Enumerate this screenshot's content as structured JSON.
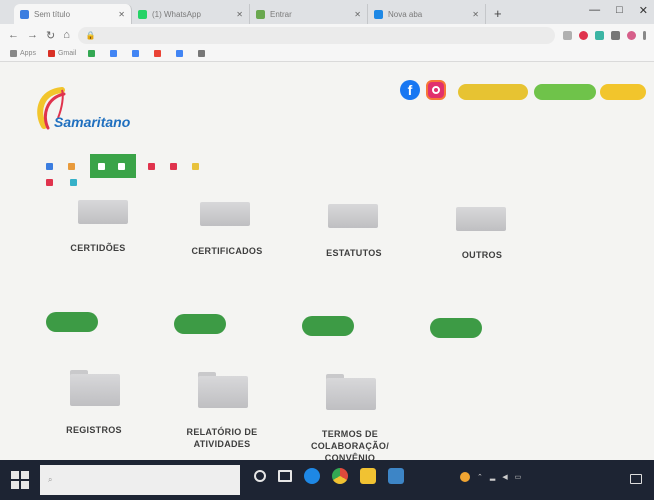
{
  "browser": {
    "tabs": [
      {
        "title": "Sem título",
        "color": "#3b7de0",
        "active": true
      },
      {
        "title": "(1) WhatsApp",
        "color": "#25d366",
        "active": false
      },
      {
        "title": "Entrar",
        "color": "#6aa84f",
        "active": false
      },
      {
        "title": "Nova aba",
        "color": "#1e88e5",
        "active": false
      }
    ],
    "new_tab_label": "+",
    "window_controls": [
      "—",
      "□",
      "✕"
    ],
    "nav_buttons": [
      "←",
      "→",
      "↻",
      "⌂"
    ],
    "lock_icon": "lock-icon",
    "url": "",
    "bookmarks": [
      {
        "label": "Apps",
        "color": "#888888"
      },
      {
        "label": "Gmail",
        "color": "#d93025"
      },
      {
        "label": "",
        "color": "#34a853"
      },
      {
        "label": "",
        "color": "#4285f4"
      },
      {
        "label": "",
        "color": "#4285f4"
      },
      {
        "label": "",
        "color": "#ea4335"
      },
      {
        "label": "",
        "color": "#4285f4"
      },
      {
        "label": "",
        "color": "#777777"
      }
    ]
  },
  "site": {
    "logo_text": "Samaritano",
    "logo_sub": "",
    "social": {
      "facebook": "f",
      "instagram": "instagram-icon"
    },
    "pills": [
      "",
      "",
      ""
    ],
    "nav_row1": [
      {
        "label": "",
        "color": "#3b7de0",
        "highlight": false
      },
      {
        "label": "",
        "color": "#e89a3c",
        "highlight": false
      }
    ],
    "nav_highlight": [
      "",
      ""
    ],
    "nav_row1_after": [
      {
        "label": "",
        "color": "#e0334d"
      },
      {
        "label": "",
        "color": "#e0334d"
      },
      {
        "label": "",
        "color": "#e8c23c"
      }
    ],
    "nav_row2": [
      {
        "label": "",
        "color": "#e0334d"
      },
      {
        "label": "",
        "color": "#35b0c8"
      }
    ]
  },
  "folders_row1": [
    {
      "label": "CERTIDÕES"
    },
    {
      "label": "CERTIFICADOS"
    },
    {
      "label": "ESTATUTOS"
    },
    {
      "label": "OUTROS"
    }
  ],
  "view_buttons": [
    "",
    "",
    "",
    ""
  ],
  "folders_row2": [
    {
      "label": "REGISTROS"
    },
    {
      "label": "RELATÓRIO DE ATIVIDADES"
    },
    {
      "label": "TERMOS DE COLABORAÇÃO/ CONVÊNIO"
    }
  ],
  "taskbar": {
    "search_placeholder": "",
    "apps": [
      {
        "name": "cortana",
        "color": "#e6e6e6"
      },
      {
        "name": "task-view",
        "color": "#e6e6e6"
      },
      {
        "name": "edge",
        "color": "#1e88e5"
      },
      {
        "name": "chrome",
        "color": "#e0493b"
      },
      {
        "name": "explorer",
        "color": "#f1c232"
      },
      {
        "name": "store",
        "color": "#3d85c6"
      }
    ],
    "time": "",
    "date": ""
  }
}
